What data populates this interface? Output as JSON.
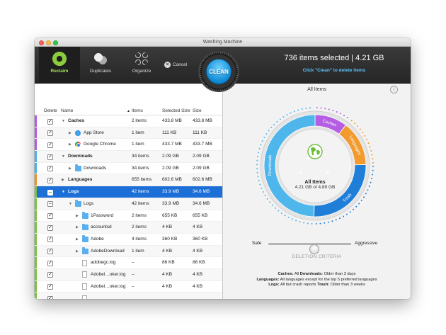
{
  "window": {
    "title": "Washing Machine"
  },
  "toolbar": {
    "tools": [
      {
        "label": "Reclaim",
        "icon": "reclaim-icon",
        "active": true
      },
      {
        "label": "Duplicates",
        "icon": "duplicates-icon",
        "active": false
      },
      {
        "label": "Organize",
        "icon": "organize-icon",
        "active": false
      }
    ],
    "cancel_label": "Cancel",
    "clean_label": "CLEAN",
    "selection_summary": "736 items selected | 4.21 GB",
    "hint": "Click \"Clean\" to delete items"
  },
  "table": {
    "headers": {
      "delete": "Delete",
      "name": "Name",
      "items": "Items",
      "selected_size": "Selected Size",
      "size": "Size"
    },
    "rows": [
      {
        "name": "Caches",
        "bold": true,
        "level": 0,
        "expanded": true,
        "check": "✓",
        "items": "2 items",
        "selected_size": "433.8 MB",
        "size": "433.8 MB",
        "stripe": "#b05ee0",
        "icon": ""
      },
      {
        "name": "App Store",
        "bold": false,
        "level": 1,
        "expanded": false,
        "check": "✓",
        "items": "1 item",
        "selected_size": "111 KB",
        "size": "111 KB",
        "stripe": "#b05ee0",
        "icon": "appstore"
      },
      {
        "name": "Google Chrome",
        "bold": false,
        "level": 1,
        "expanded": false,
        "check": "✓",
        "items": "1 item",
        "selected_size": "433.7 MB",
        "size": "433.7 MB",
        "stripe": "#b05ee0",
        "icon": "chrome"
      },
      {
        "name": "Downloads",
        "bold": true,
        "level": 0,
        "expanded": true,
        "check": "✓",
        "items": "34 items",
        "selected_size": "2.09 GB",
        "size": "2.09 GB",
        "stripe": "#4ab2ea",
        "icon": ""
      },
      {
        "name": "Downloads",
        "bold": false,
        "level": 1,
        "expanded": false,
        "check": "✓",
        "items": "34 items",
        "selected_size": "2.09 GB",
        "size": "2.09 GB",
        "stripe": "#4ab2ea",
        "icon": "folder"
      },
      {
        "name": "Languages",
        "bold": true,
        "level": 0,
        "expanded": false,
        "check": "✓",
        "items": "655 items",
        "selected_size": "602.6 MB",
        "size": "602.6 MB",
        "stripe": "#f0902a",
        "icon": ""
      },
      {
        "name": "Logs",
        "bold": true,
        "level": 0,
        "expanded": true,
        "check": "–",
        "items": "42 items",
        "selected_size": "33.9 MB",
        "size": "34.6 MB",
        "stripe": "#7bc242",
        "icon": "",
        "selected": true
      },
      {
        "name": "Logs",
        "bold": false,
        "level": 1,
        "expanded": true,
        "check": "–",
        "items": "42 items",
        "selected_size": "33.9 MB",
        "size": "34.6 MB",
        "stripe": "#7bc242",
        "icon": "folder"
      },
      {
        "name": "1Password",
        "bold": false,
        "level": 2,
        "expanded": false,
        "check": "✓",
        "items": "2 items",
        "selected_size": "655 KB",
        "size": "655 KB",
        "stripe": "#7bc242",
        "icon": "folder"
      },
      {
        "name": "accountsd",
        "bold": false,
        "level": 2,
        "expanded": false,
        "check": "✓",
        "items": "2 items",
        "selected_size": "4 KB",
        "size": "4 KB",
        "stripe": "#7bc242",
        "icon": "folder"
      },
      {
        "name": "Adobe",
        "bold": false,
        "level": 2,
        "expanded": false,
        "check": "✓",
        "items": "4 items",
        "selected_size": "360 KB",
        "size": "360 KB",
        "stripe": "#7bc242",
        "icon": "folder"
      },
      {
        "name": "AdobeDownload",
        "bold": false,
        "level": 2,
        "expanded": false,
        "check": "✓",
        "items": "1 item",
        "selected_size": "4 KB",
        "size": "4 KB",
        "stripe": "#7bc242",
        "icon": "folder"
      },
      {
        "name": "adobegc.log",
        "bold": false,
        "level": 2,
        "expanded": null,
        "check": "✓",
        "items": "–",
        "selected_size": "86 KB",
        "size": "86 KB",
        "stripe": "#7bc242",
        "icon": "file"
      },
      {
        "name": "Adobel…oker.log",
        "bold": false,
        "level": 2,
        "expanded": null,
        "check": "✓",
        "items": "–",
        "selected_size": "4 KB",
        "size": "4 KB",
        "stripe": "#7bc242",
        "icon": "file"
      },
      {
        "name": "Adobel…oker.log",
        "bold": false,
        "level": 2,
        "expanded": null,
        "check": "✓",
        "items": "–",
        "selected_size": "4 KB",
        "size": "4 KB",
        "stripe": "#7bc242",
        "icon": "file"
      },
      {
        "name": "",
        "bold": false,
        "level": 2,
        "expanded": null,
        "check": "✓",
        "items": "",
        "selected_size": "",
        "size": "",
        "stripe": "#7bc242",
        "icon": "file"
      }
    ]
  },
  "panel": {
    "title": "All Items",
    "center_title": "All Items",
    "center_sub": "4.21 GB of 4.89 GB",
    "segments": [
      {
        "label": "Caches",
        "value_gb": 0.434,
        "color": "#b55ee3"
      },
      {
        "label": "Languages",
        "value_gb": 0.603,
        "color": "#f29a2e"
      },
      {
        "label": "Trash",
        "value_gb": 1.08,
        "color": "#1f7fd8"
      },
      {
        "label": "Downloads",
        "value_gb": 2.09,
        "color": "#4fb6ec"
      }
    ],
    "slider": {
      "left_label": "Safe",
      "right_label": "Aggressive",
      "level": 0.55
    },
    "criteria_title": "DELETION CRITERIA",
    "criteria": [
      {
        "k1": "Caches:",
        "v1": " All   ",
        "k2": "Downloads:",
        "v2": " Older than 3 days"
      },
      {
        "k1": "Languages:",
        "v1": " All languages except for the top 5 preferred languages",
        "k2": "",
        "v2": ""
      },
      {
        "k1": "Logs:",
        "v1": " All but crash reports   ",
        "k2": "Trash:",
        "v2": " Older than 3 weeks"
      }
    ]
  }
}
